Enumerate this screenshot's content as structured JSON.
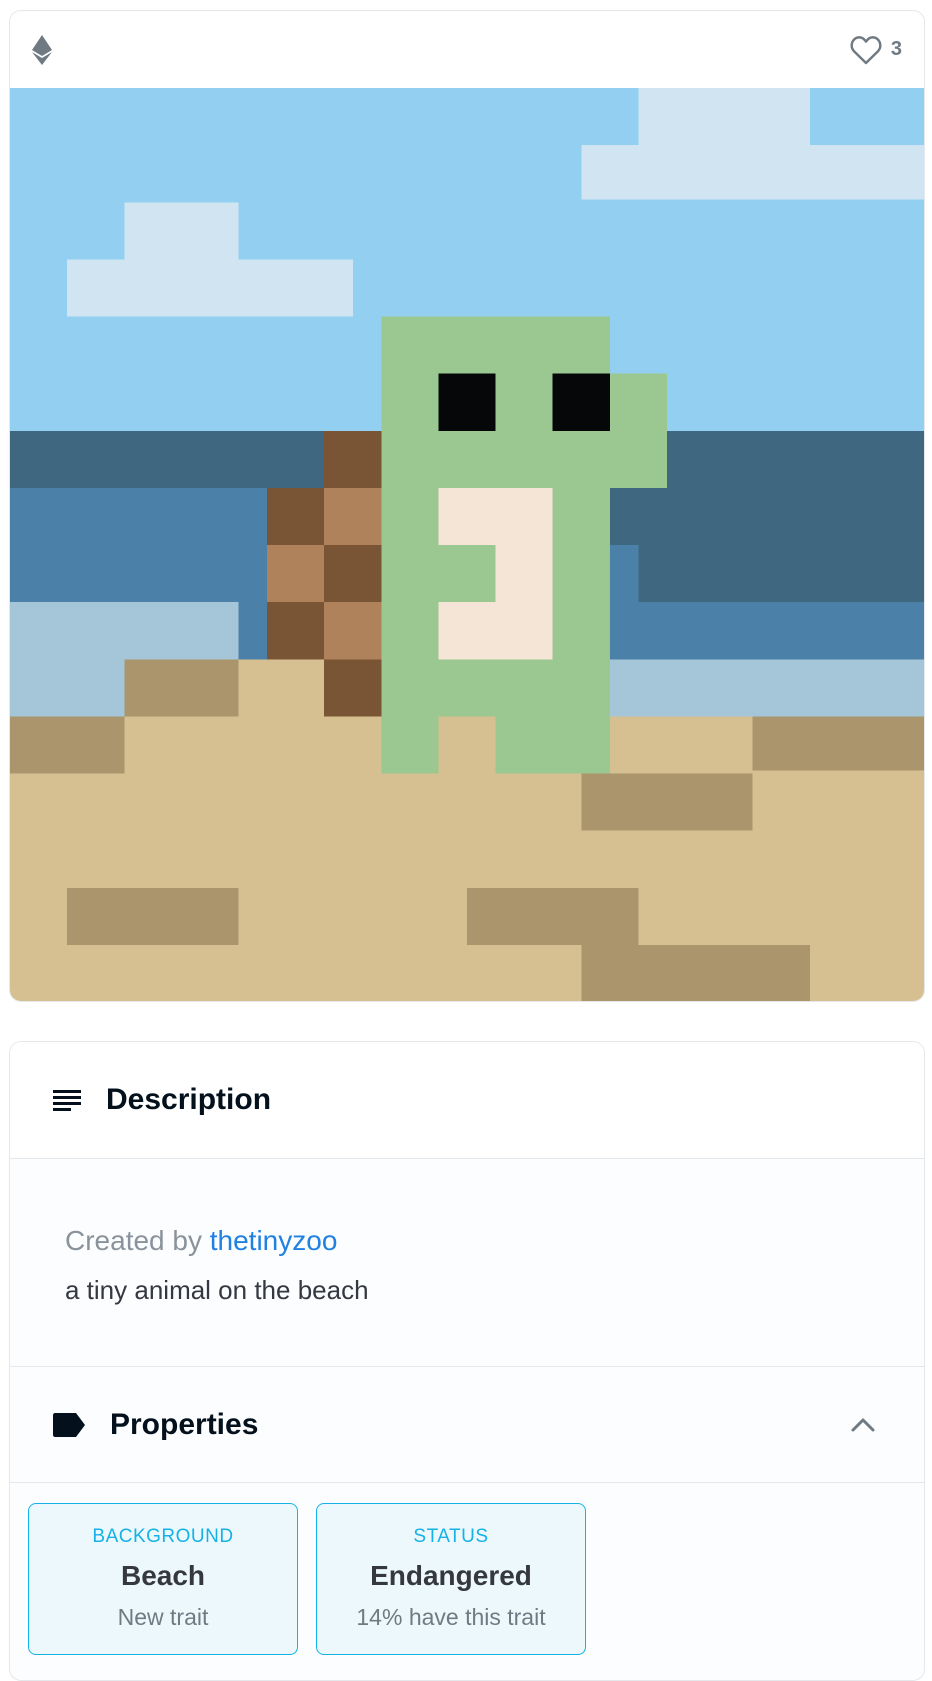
{
  "asset": {
    "favorites_count": "3",
    "image_alt": "a tiny animal on the beach pixel art",
    "chain_icon": "ethereum-icon",
    "favorite_icon": "heart-outline-icon"
  },
  "description": {
    "title": "Description",
    "created_by_prefix": "Created by",
    "creator": "thetinyzoo",
    "text": "a tiny animal on the beach",
    "icon": "lines-icon"
  },
  "properties": {
    "title": "Properties",
    "icon": "tag-icon",
    "toggle_icon": "chevron-up-icon",
    "traits": [
      {
        "type": "Background",
        "value": "Beach",
        "rarity": "New trait"
      },
      {
        "type": "Status",
        "value": "Endangered",
        "rarity": "14% have this trait"
      }
    ]
  },
  "colors": {
    "sky": "#93cff0",
    "cloud": "#d1e4f1",
    "sea_dark": "#3f6780",
    "sea": "#4b81a9",
    "shallow": "#a5c5d8",
    "sand": "#d6bf91",
    "sand_dark": "#ab956d",
    "dino": "#9bc890",
    "belly": "#f5e5d6",
    "eye": "#060708",
    "trunk_dark": "#795435",
    "trunk_light": "#b0825c",
    "accent": "#2081e2",
    "trait_border": "#15b2e5"
  }
}
